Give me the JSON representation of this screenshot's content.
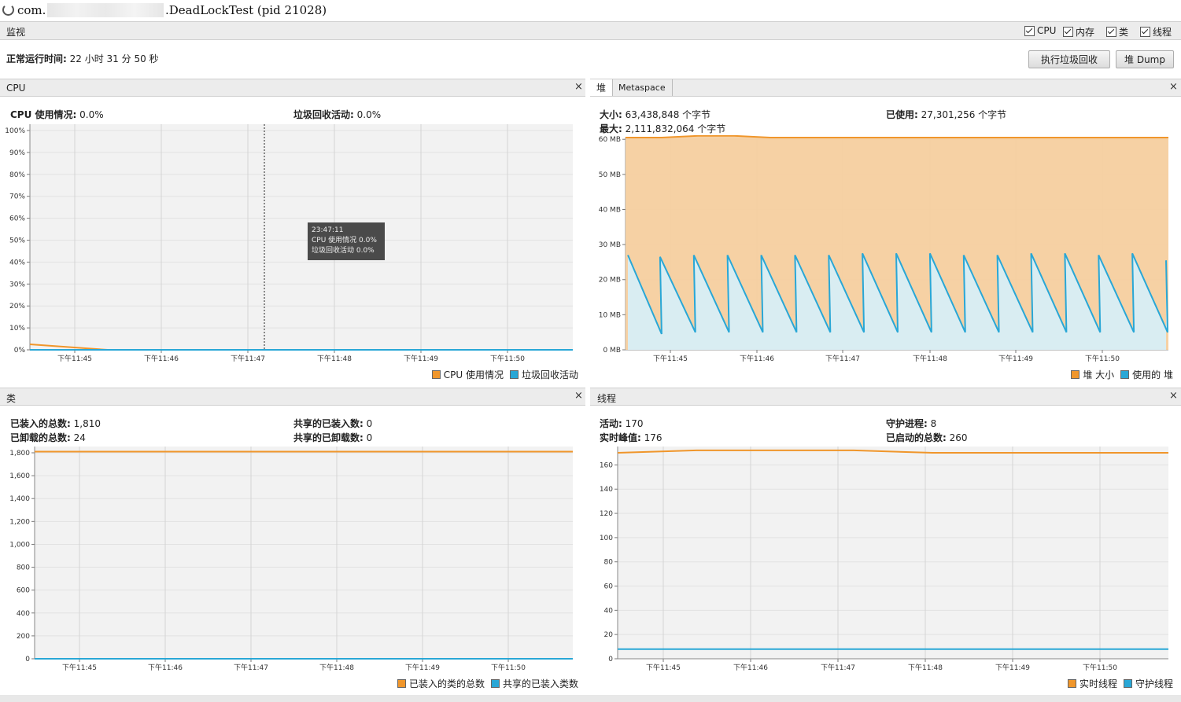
{
  "window": {
    "title_prefix": "com.",
    "title_suffix": ".DeadLockTest (pid 21028)"
  },
  "toolbar": {
    "monitor_label": "监视",
    "checkboxes": [
      {
        "label": "CPU",
        "checked": true
      },
      {
        "label": "内存",
        "checked": true
      },
      {
        "label": "类",
        "checked": true
      },
      {
        "label": "线程",
        "checked": true
      }
    ],
    "uptime_label": "正常运行时间:",
    "uptime_value": "22 小时 31 分 50 秒",
    "gc_button": "执行垃圾回收",
    "heap_dump_button": "堆 Dump"
  },
  "cpu_panel": {
    "title": "CPU",
    "close": "×",
    "cpu_usage_label": "CPU 使用情况:",
    "cpu_usage_value": "0.0%",
    "gc_activity_label": "垃圾回收活动:",
    "gc_activity_value": "0.0%",
    "legend": [
      "CPU 使用情况",
      "垃圾回收活动"
    ],
    "tooltip": {
      "time": "23:47:11",
      "cpu": "CPU 使用情况  0.0%",
      "gc": "垃圾回收活动  0.0%"
    }
  },
  "heap_panel": {
    "tab_heap": "堆",
    "tab_metaspace": "Metaspace",
    "close": "×",
    "size_label": "大小:",
    "size_value": "63,438,848 个字节",
    "used_label": "已使用:",
    "used_value": "27,301,256 个字节",
    "max_label": "最大:",
    "max_value": "2,111,832,064 个字节",
    "legend": [
      "堆 大小",
      "使用的 堆"
    ]
  },
  "classes_panel": {
    "title": "类",
    "close": "×",
    "loaded_label": "已装入的总数:",
    "loaded_value": "1,810",
    "unloaded_label": "已卸载的总数:",
    "unloaded_value": "24",
    "shared_loaded_label": "共享的已装入数:",
    "shared_loaded_value": "0",
    "shared_unloaded_label": "共享的已卸载数:",
    "shared_unloaded_value": "0",
    "legend": [
      "已装入的类的总数",
      "共享的已装入类数"
    ]
  },
  "threads_panel": {
    "title": "线程",
    "close": "×",
    "live_label": "活动:",
    "live_value": "170",
    "peak_label": "实时峰值:",
    "peak_value": "176",
    "daemon_label": "守护进程:",
    "daemon_value": "8",
    "started_label": "已启动的总数:",
    "started_value": "260",
    "legend": [
      "实时线程",
      "守护线程"
    ]
  },
  "colors": {
    "orange": "#f0962b",
    "blue": "#29a7d6",
    "heap_fill": "#f6cf9f",
    "used_fill": "#d6f0fb",
    "plot_bg": "#f2f2f2"
  },
  "chart_data": [
    {
      "type": "line",
      "title": "CPU",
      "x_ticks": [
        "下午11:45",
        "下午11:46",
        "下午11:47",
        "下午11:48",
        "下午11:49",
        "下午11:50"
      ],
      "y_ticks": [
        "0%",
        "10%",
        "20%",
        "30%",
        "40%",
        "50%",
        "60%",
        "70%",
        "80%",
        "90%",
        "100%"
      ],
      "ylim": [
        0,
        100
      ],
      "series": [
        {
          "name": "CPU 使用情况",
          "values": [
            2.5,
            0,
            0,
            0,
            0,
            0,
            0,
            0
          ]
        },
        {
          "name": "垃圾回收活动",
          "values": [
            0,
            0,
            0,
            0,
            0,
            0,
            0,
            0
          ]
        }
      ]
    },
    {
      "type": "area",
      "title": "堆",
      "x_ticks": [
        "下午11:45",
        "下午11:46",
        "下午11:47",
        "下午11:48",
        "下午11:49",
        "下午11:50"
      ],
      "y_ticks": [
        "0 MB",
        "10 MB",
        "20 MB",
        "30 MB",
        "40 MB",
        "50 MB",
        "60 MB"
      ],
      "ylim": [
        0,
        60.5
      ],
      "series": [
        {
          "name": "堆 大小",
          "values": [
            60.5,
            60.5,
            61,
            61,
            60.5,
            60.5,
            60.5,
            60.5,
            60.5,
            60.5,
            60.5,
            60.5,
            60.5,
            60.5,
            60.5,
            60.5
          ]
        },
        {
          "name": "使用的 堆",
          "values": [
            27,
            4.5,
            26.5,
            5,
            27,
            5,
            27,
            5,
            27,
            5,
            27,
            5,
            27,
            5,
            27.5,
            5,
            27.5,
            5,
            27.5,
            5,
            27,
            5,
            27,
            5,
            27.5,
            5,
            27.5,
            5,
            27,
            5,
            27.5,
            5,
            25.5
          ]
        }
      ]
    },
    {
      "type": "line",
      "title": "类",
      "x_ticks": [
        "下午11:45",
        "下午11:46",
        "下午11:47",
        "下午11:48",
        "下午11:49",
        "下午11:50"
      ],
      "y_ticks": [
        "0",
        "200",
        "400",
        "600",
        "800",
        "1,000",
        "1,200",
        "1,400",
        "1,600",
        "1,800"
      ],
      "ylim": [
        0,
        1800
      ],
      "series": [
        {
          "name": "已装入的类的总数",
          "values": [
            1810,
            1810,
            1810,
            1810,
            1810,
            1810
          ]
        },
        {
          "name": "共享的已装入类数",
          "values": [
            0,
            0,
            0,
            0,
            0,
            0
          ]
        }
      ]
    },
    {
      "type": "line",
      "title": "线程",
      "x_ticks": [
        "下午11:45",
        "下午11:46",
        "下午11:47",
        "下午11:48",
        "下午11:49",
        "下午11:50"
      ],
      "y_ticks": [
        "0",
        "20",
        "40",
        "60",
        "80",
        "100",
        "120",
        "140",
        "160"
      ],
      "ylim": [
        0,
        170
      ],
      "series": [
        {
          "name": "实时线程",
          "values": [
            170,
            172,
            172,
            172,
            170,
            170,
            170,
            170
          ]
        },
        {
          "name": "守护线程",
          "values": [
            8,
            8,
            8,
            8,
            8,
            8,
            8,
            8
          ]
        }
      ]
    }
  ]
}
